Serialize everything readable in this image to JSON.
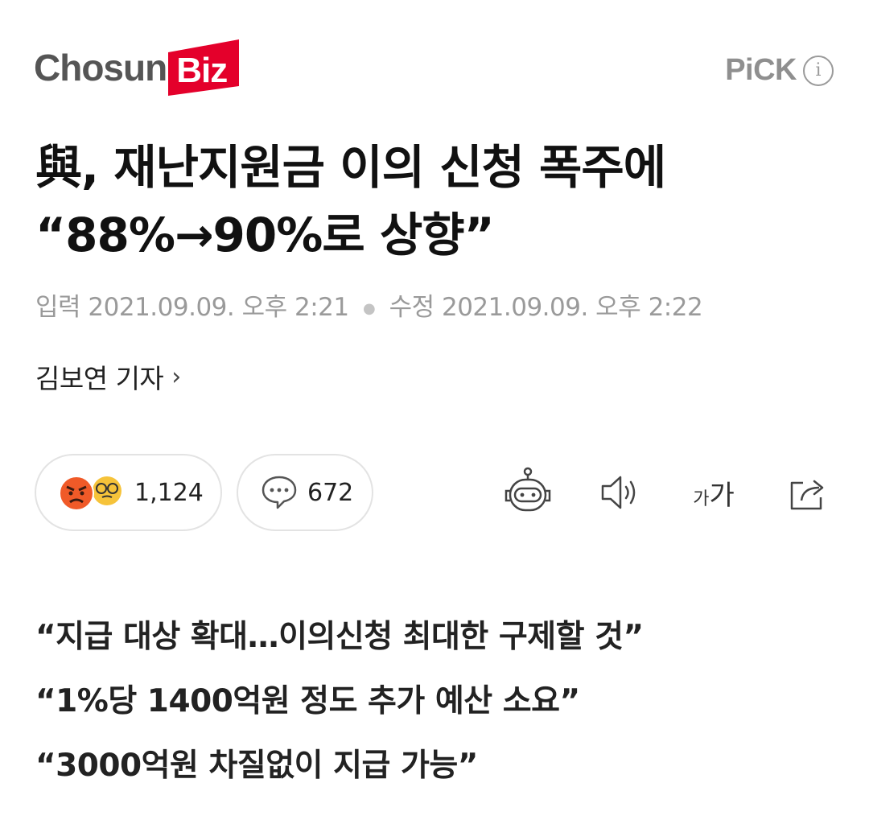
{
  "logo": {
    "text": "Chosun",
    "accent": "Biz",
    "accent_color": "#e4002b"
  },
  "pick": {
    "label": "PiCK",
    "info_icon": "info-icon"
  },
  "headline": {
    "line1": "與, 재난지원금 이의 신청 폭주에",
    "line2": "“88%→90%로 상향”"
  },
  "meta": {
    "input_label": "입력",
    "input_time": "2021.09.09. 오후 2:21",
    "edit_label": "수정",
    "edit_time": "2021.09.09. 오후 2:22"
  },
  "reporter": {
    "name": "김보연 기자",
    "chevron": "›"
  },
  "actions": {
    "reactions_count": "1,124",
    "comments_count": "672",
    "font_size_small": "가",
    "font_size_large": "가",
    "icons": [
      "angry-emoji-icon",
      "glasses-emoji-icon",
      "comment-icon",
      "robot-summary-icon",
      "speaker-icon",
      "share-icon"
    ]
  },
  "subheads": [
    "“지급 대상 확대…이의신청 최대한 구제할 것”",
    "“1%당 1400억원 정도 추가 예산 소요”",
    "“3000억원 차질없이 지급 가능”"
  ]
}
